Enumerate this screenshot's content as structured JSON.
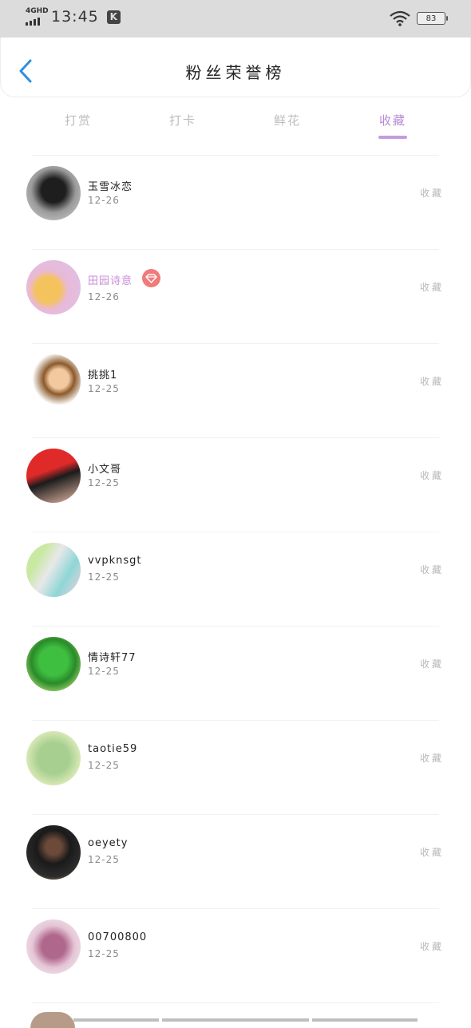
{
  "status_bar": {
    "network": "4GHD",
    "time": "13:45",
    "app_badge": "K",
    "battery": "83"
  },
  "header": {
    "title": "粉丝荣誉榜"
  },
  "tabs": [
    {
      "label": "打赏",
      "active": false
    },
    {
      "label": "打卡",
      "active": false
    },
    {
      "label": "鲜花",
      "active": false
    },
    {
      "label": "收藏",
      "active": true
    }
  ],
  "fans": [
    {
      "name": "玉雪冰恋",
      "date": "12-26",
      "action": "收藏",
      "vip": false
    },
    {
      "name": "田园诗意",
      "date": "12-26",
      "action": "收藏",
      "vip": true
    },
    {
      "name": "挑挑1",
      "date": "12-25",
      "action": "收藏",
      "vip": false
    },
    {
      "name": "小文哥",
      "date": "12-25",
      "action": "收藏",
      "vip": false
    },
    {
      "name": "vvpknsgt",
      "date": "12-25",
      "action": "收藏",
      "vip": false
    },
    {
      "name": "情诗轩77",
      "date": "12-25",
      "action": "收藏",
      "vip": false
    },
    {
      "name": "taotie59",
      "date": "12-25",
      "action": "收藏",
      "vip": false
    },
    {
      "name": "oeyety",
      "date": "12-25",
      "action": "收藏",
      "vip": false
    },
    {
      "name": "00700800",
      "date": "12-25",
      "action": "收藏",
      "vip": false
    }
  ],
  "colors": {
    "accent": "#c59be0",
    "back_arrow": "#2f8fe0",
    "vip_name": "#c98bd9",
    "vip_badge": "#f17a7a"
  }
}
